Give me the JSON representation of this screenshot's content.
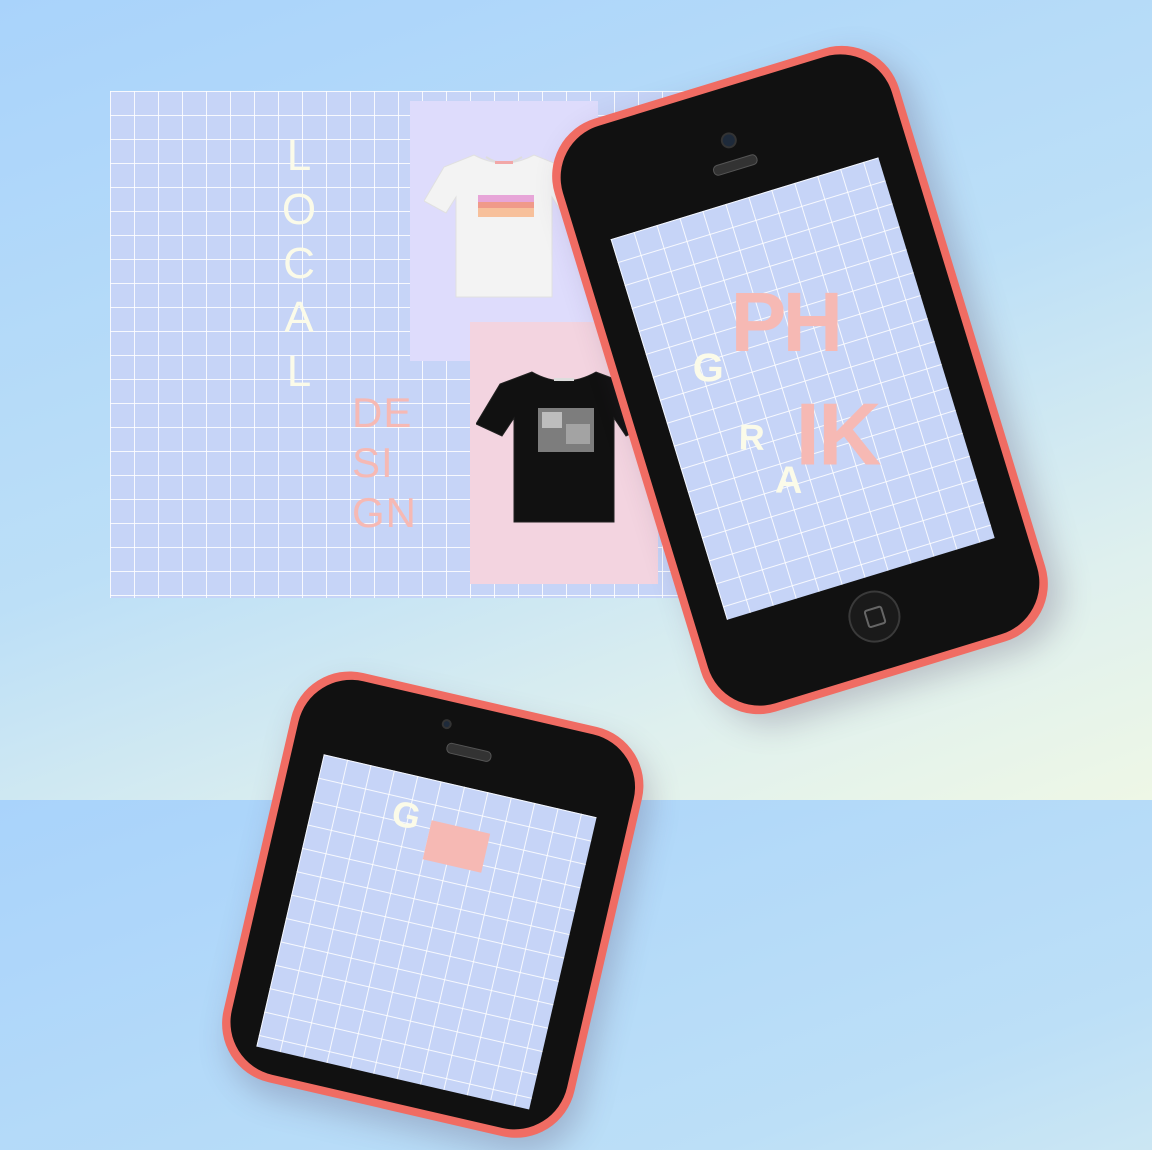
{
  "poster": {
    "word_vertical": "LOCAL",
    "design_lines": [
      "DE",
      "SI",
      "GN"
    ]
  },
  "phone_screen": {
    "letters": [
      "G",
      "PH",
      "R",
      "IK",
      "A"
    ]
  },
  "phone_bottom": {
    "letter": "G"
  },
  "colors": {
    "phone_shell": "#f06c63",
    "grid_bg": "#c6d4f7",
    "card_lavender": "#dedcfc",
    "card_pink": "#f3d4e0",
    "cream_text": "#fbfbe9",
    "pink_text": "#f6b9b4"
  }
}
